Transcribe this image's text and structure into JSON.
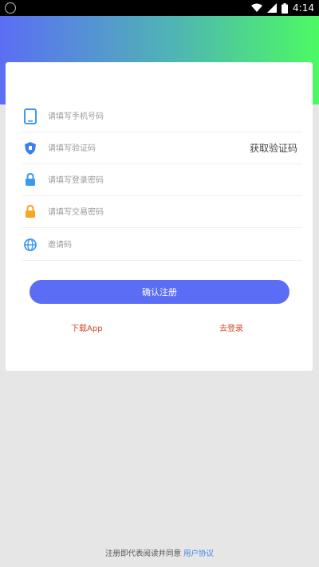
{
  "status_bar": {
    "time": "4:14"
  },
  "form": {
    "phone_placeholder": "请填写手机号码",
    "code_placeholder": "请填写验证码",
    "get_code_label": "获取验证码",
    "login_password_placeholder": "请填写登录密码",
    "trade_password_placeholder": "请填写交易密码",
    "invite_placeholder": "邀请码"
  },
  "actions": {
    "submit_label": "确认注册",
    "download_label": "下载App",
    "login_label": "去登录"
  },
  "footer": {
    "text": "注册即代表阅读并同意",
    "agreement_label": "用户协议"
  },
  "colors": {
    "accent": "#5b6cf5",
    "link": "#d44a2a",
    "agreement": "#3a86e8",
    "gradient_start": "#5b6ef5",
    "gradient_end": "#4cfa63"
  }
}
